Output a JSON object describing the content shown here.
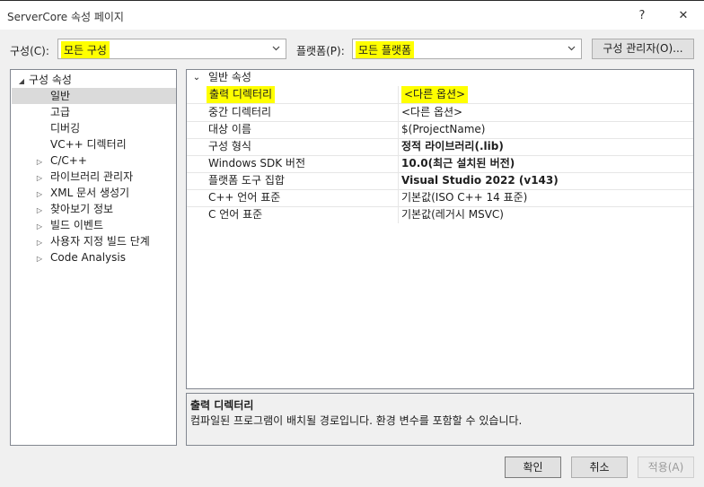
{
  "window": {
    "title": "ServerCore 속성 페이지",
    "help_glyph": "?",
    "close_glyph": "✕"
  },
  "toolbar": {
    "config_label": "구성(C):",
    "config_value": "모든 구성",
    "platform_label": "플랫폼(P):",
    "platform_value": "모든 플랫폼",
    "config_manager_label": "구성 관리자(O)..."
  },
  "tree": {
    "root_label": "구성 속성",
    "items": [
      {
        "label": "일반",
        "expandable": false,
        "selected": true
      },
      {
        "label": "고급",
        "expandable": false
      },
      {
        "label": "디버깅",
        "expandable": false
      },
      {
        "label": "VC++ 디렉터리",
        "expandable": false
      },
      {
        "label": "C/C++",
        "expandable": true
      },
      {
        "label": "라이브러리 관리자",
        "expandable": true
      },
      {
        "label": "XML 문서 생성기",
        "expandable": true
      },
      {
        "label": "찾아보기 정보",
        "expandable": true
      },
      {
        "label": "빌드 이벤트",
        "expandable": true
      },
      {
        "label": "사용자 지정 빌드 단계",
        "expandable": true
      },
      {
        "label": "Code Analysis",
        "expandable": true
      }
    ]
  },
  "grid": {
    "category": "일반 속성",
    "rows": [
      {
        "name": "출력 디렉터리",
        "value": "<다른 옵션>",
        "bold": false,
        "highlight": true
      },
      {
        "name": "중간 디렉터리",
        "value": "<다른 옵션>",
        "bold": false
      },
      {
        "name": "대상 이름",
        "value": "$(ProjectName)",
        "bold": false
      },
      {
        "name": "구성 형식",
        "value": "정적 라이브러리(.lib)",
        "bold": true
      },
      {
        "name": "Windows SDK 버전",
        "value": "10.0(최근 설치된 버전)",
        "bold": true
      },
      {
        "name": "플랫폼 도구 집합",
        "value": "Visual Studio 2022 (v143)",
        "bold": true
      },
      {
        "name": "C++ 언어 표준",
        "value": "기본값(ISO C++ 14 표준)",
        "bold": false
      },
      {
        "name": "C 언어 표준",
        "value": "기본값(레거시 MSVC)",
        "bold": false
      }
    ]
  },
  "description": {
    "title": "출력 디렉터리",
    "text": "컴파일된 프로그램이 배치될 경로입니다. 환경 변수를 포함할 수 있습니다."
  },
  "footer": {
    "ok_label": "확인",
    "cancel_label": "취소",
    "apply_label": "적용(A)"
  },
  "colors": {
    "highlight": "#ffff00",
    "selected_tree_bg": "#dadada",
    "window_bg": "#f0f0f0"
  }
}
